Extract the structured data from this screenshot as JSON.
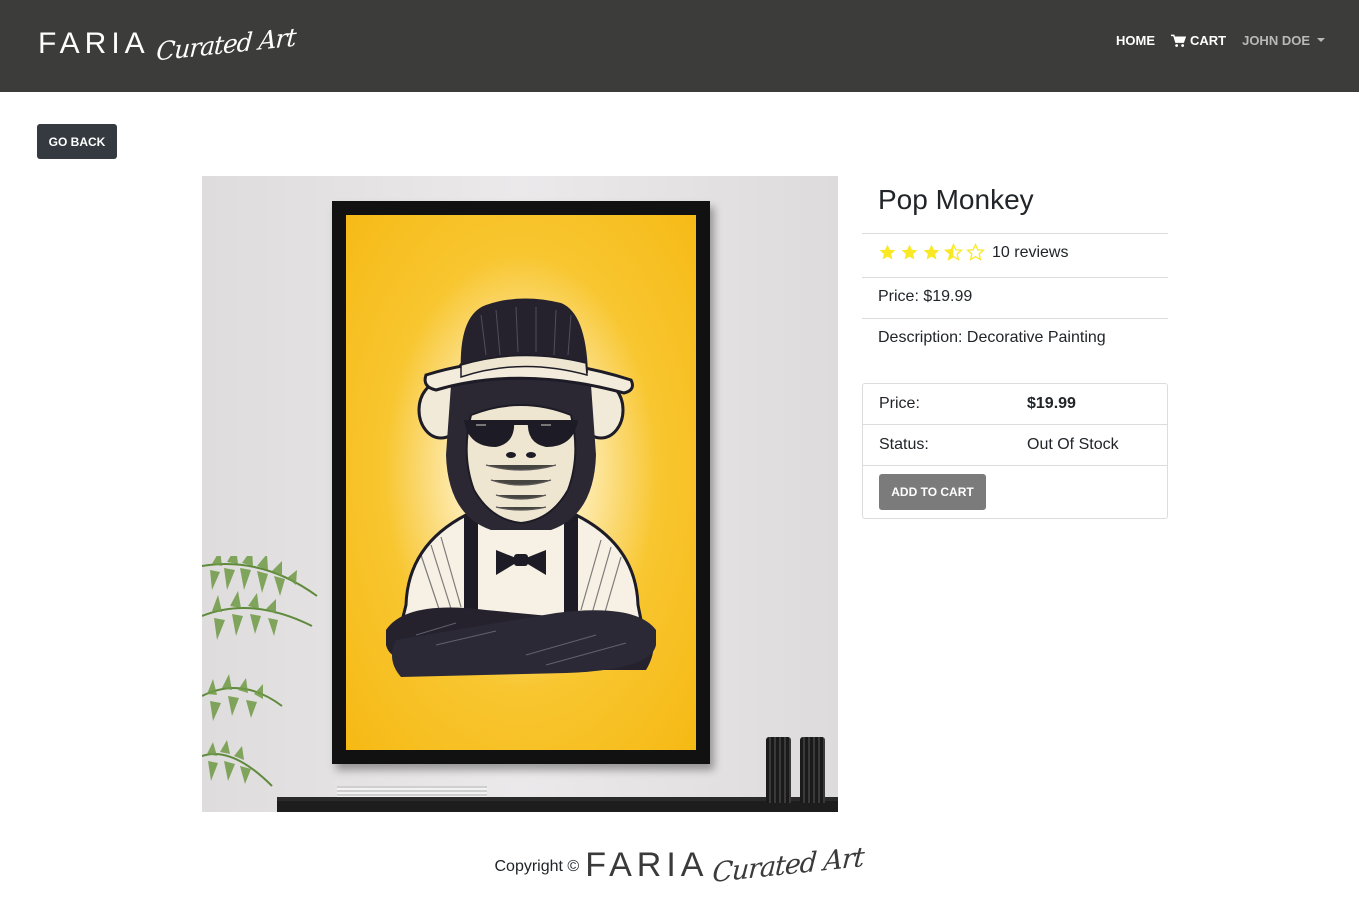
{
  "nav": {
    "brand_word": "FARIA",
    "brand_script": "Curated Art",
    "home": "HOME",
    "cart": "CART",
    "user": "JOHN DOE"
  },
  "go_back": "GO BACK",
  "product": {
    "title": "Pop Monkey",
    "rating": 3.5,
    "reviews_text": "10 reviews",
    "price_line": "Price: $19.99",
    "description_line": "Description: Decorative Painting"
  },
  "card": {
    "price_label": "Price:",
    "price_value": "$19.99",
    "status_label": "Status:",
    "status_value": "Out Of Stock",
    "add_to_cart": "ADD TO CART"
  },
  "footer": {
    "copyright": "Copyright ©",
    "brand_word": "FARIA",
    "brand_script": "Curated Art"
  },
  "colors": {
    "navbar": "#3c3c3a",
    "star": "#f8e825",
    "button_dark": "#343a40",
    "button_disabled": "#7b7b7b"
  }
}
